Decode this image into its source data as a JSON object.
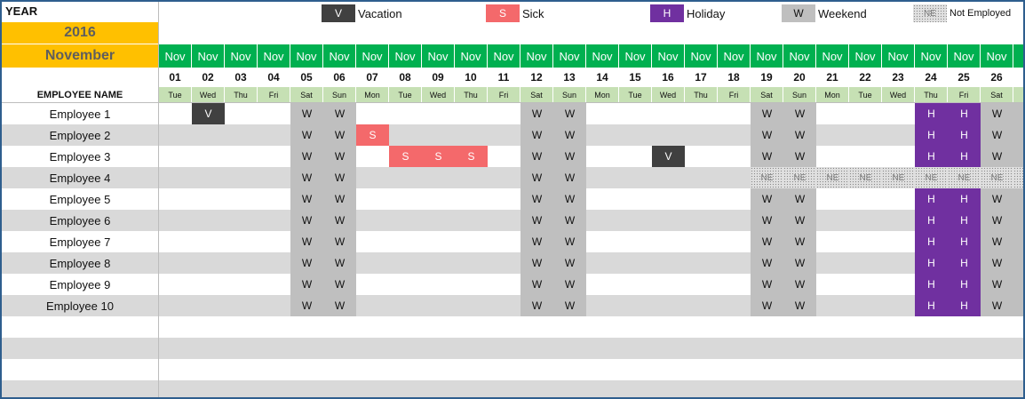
{
  "header": {
    "year_label": "YEAR",
    "year_value": "2016",
    "month_value": "November",
    "employee_header": "EMPLOYEE NAME"
  },
  "legend": [
    {
      "code": "V",
      "label": "Vacation",
      "color": "#404040",
      "text_color": "#ffffff"
    },
    {
      "code": "S",
      "label": "Sick",
      "color": "#f4696b",
      "text_color": "#ffffff"
    },
    {
      "code": "H",
      "label": "Holiday",
      "color": "#7030a0",
      "text_color": "#ffffff"
    },
    {
      "code": "W",
      "label": "Weekend",
      "color": "#bfbfbf",
      "text_color": "#111111"
    },
    {
      "code": "NE",
      "label": "Not Employed",
      "color": "#e0e0e0",
      "text_color": "#7a7a7a"
    }
  ],
  "colors": {
    "accent_gold": "#ffc000",
    "header_green": "#00b050",
    "dow_green": "#c6e0b4",
    "row_shade": "#d9d9d9",
    "border_blue": "#2e5e8e"
  },
  "days": [
    {
      "month": "Nov",
      "day": "01",
      "dow": "Tue"
    },
    {
      "month": "Nov",
      "day": "02",
      "dow": "Wed"
    },
    {
      "month": "Nov",
      "day": "03",
      "dow": "Thu"
    },
    {
      "month": "Nov",
      "day": "04",
      "dow": "Fri"
    },
    {
      "month": "Nov",
      "day": "05",
      "dow": "Sat"
    },
    {
      "month": "Nov",
      "day": "06",
      "dow": "Sun"
    },
    {
      "month": "Nov",
      "day": "07",
      "dow": "Mon"
    },
    {
      "month": "Nov",
      "day": "08",
      "dow": "Tue"
    },
    {
      "month": "Nov",
      "day": "09",
      "dow": "Wed"
    },
    {
      "month": "Nov",
      "day": "10",
      "dow": "Thu"
    },
    {
      "month": "Nov",
      "day": "11",
      "dow": "Fri"
    },
    {
      "month": "Nov",
      "day": "12",
      "dow": "Sat"
    },
    {
      "month": "Nov",
      "day": "13",
      "dow": "Sun"
    },
    {
      "month": "Nov",
      "day": "14",
      "dow": "Mon"
    },
    {
      "month": "Nov",
      "day": "15",
      "dow": "Tue"
    },
    {
      "month": "Nov",
      "day": "16",
      "dow": "Wed"
    },
    {
      "month": "Nov",
      "day": "17",
      "dow": "Thu"
    },
    {
      "month": "Nov",
      "day": "18",
      "dow": "Fri"
    },
    {
      "month": "Nov",
      "day": "19",
      "dow": "Sat"
    },
    {
      "month": "Nov",
      "day": "20",
      "dow": "Sun"
    },
    {
      "month": "Nov",
      "day": "21",
      "dow": "Mon"
    },
    {
      "month": "Nov",
      "day": "22",
      "dow": "Tue"
    },
    {
      "month": "Nov",
      "day": "23",
      "dow": "Wed"
    },
    {
      "month": "Nov",
      "day": "24",
      "dow": "Thu"
    },
    {
      "month": "Nov",
      "day": "25",
      "dow": "Fri"
    },
    {
      "month": "Nov",
      "day": "26",
      "dow": "Sat"
    },
    {
      "month": "N",
      "day": "",
      "dow": ""
    }
  ],
  "employees": [
    {
      "name": "Employee 1",
      "cells": [
        "",
        "V",
        "",
        "",
        "W",
        "W",
        "",
        "",
        "",
        "",
        "",
        "W",
        "W",
        "",
        "",
        "",
        "",
        "",
        "W",
        "W",
        "",
        "",
        "",
        "H",
        "H",
        "W",
        "W"
      ]
    },
    {
      "name": "Employee 2",
      "cells": [
        "",
        "",
        "",
        "",
        "W",
        "W",
        "S",
        "",
        "",
        "",
        "",
        "W",
        "W",
        "",
        "",
        "",
        "",
        "",
        "W",
        "W",
        "",
        "",
        "",
        "H",
        "H",
        "W",
        "W"
      ]
    },
    {
      "name": "Employee 3",
      "cells": [
        "",
        "",
        "",
        "",
        "W",
        "W",
        "",
        "S",
        "S",
        "S",
        "",
        "W",
        "W",
        "",
        "",
        "V",
        "",
        "",
        "W",
        "W",
        "",
        "",
        "",
        "H",
        "H",
        "W",
        "W"
      ]
    },
    {
      "name": "Employee 4",
      "cells": [
        "",
        "",
        "",
        "",
        "W",
        "W",
        "",
        "",
        "",
        "",
        "",
        "W",
        "W",
        "",
        "",
        "",
        "",
        "",
        "NE",
        "NE",
        "NE",
        "NE",
        "NE",
        "NE",
        "NE",
        "NE",
        "NE"
      ]
    },
    {
      "name": "Employee 5",
      "cells": [
        "",
        "",
        "",
        "",
        "W",
        "W",
        "",
        "",
        "",
        "",
        "",
        "W",
        "W",
        "",
        "",
        "",
        "",
        "",
        "W",
        "W",
        "",
        "",
        "",
        "H",
        "H",
        "W",
        "W"
      ]
    },
    {
      "name": "Employee 6",
      "cells": [
        "",
        "",
        "",
        "",
        "W",
        "W",
        "",
        "",
        "",
        "",
        "",
        "W",
        "W",
        "",
        "",
        "",
        "",
        "",
        "W",
        "W",
        "",
        "",
        "",
        "H",
        "H",
        "W",
        "W"
      ]
    },
    {
      "name": "Employee 7",
      "cells": [
        "",
        "",
        "",
        "",
        "W",
        "W",
        "",
        "",
        "",
        "",
        "",
        "W",
        "W",
        "",
        "",
        "",
        "",
        "",
        "W",
        "W",
        "",
        "",
        "",
        "H",
        "H",
        "W",
        "W"
      ]
    },
    {
      "name": "Employee 8",
      "cells": [
        "",
        "",
        "",
        "",
        "W",
        "W",
        "",
        "",
        "",
        "",
        "",
        "W",
        "W",
        "",
        "",
        "",
        "",
        "",
        "W",
        "W",
        "",
        "",
        "",
        "H",
        "H",
        "W",
        "W"
      ]
    },
    {
      "name": "Employee 9",
      "cells": [
        "",
        "",
        "",
        "",
        "W",
        "W",
        "",
        "",
        "",
        "",
        "",
        "W",
        "W",
        "",
        "",
        "",
        "",
        "",
        "W",
        "W",
        "",
        "",
        "",
        "H",
        "H",
        "W",
        "W"
      ]
    },
    {
      "name": "Employee 10",
      "cells": [
        "",
        "",
        "",
        "",
        "W",
        "W",
        "",
        "",
        "",
        "",
        "",
        "W",
        "W",
        "",
        "",
        "",
        "",
        "",
        "W",
        "W",
        "",
        "",
        "",
        "H",
        "H",
        "W",
        "W"
      ]
    }
  ],
  "empty_rows": 4
}
